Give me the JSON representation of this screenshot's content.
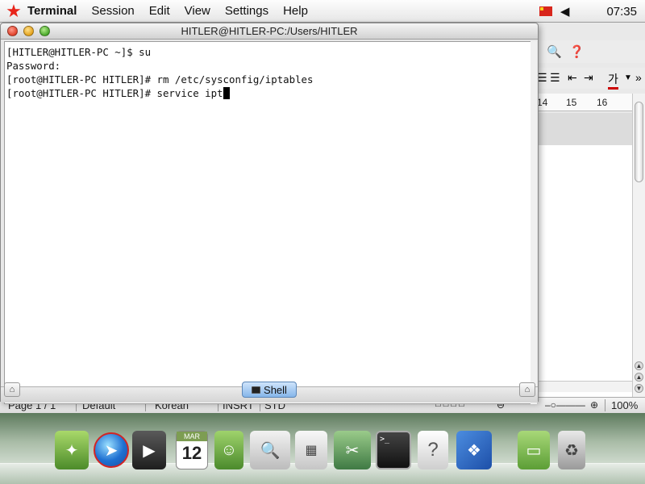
{
  "menubar": {
    "app_name": "Terminal",
    "menus": [
      "Session",
      "Edit",
      "View",
      "Settings",
      "Help"
    ],
    "clock": "07:35",
    "star_color": "#e8241a",
    "icons": [
      "star-icon",
      "flag-icon",
      "volume-icon"
    ]
  },
  "terminal": {
    "window_title": "HITLER@HITLER-PC:/Users/HITLER",
    "lines": [
      "[HITLER@HITLER-PC ~]$ su",
      "Password:",
      "[root@HITLER-PC HITLER]# rm /etc/sysconfig/iptables",
      "[root@HITLER-PC HITLER]# service ipt"
    ],
    "tab_label": "Shell"
  },
  "background_app": {
    "ruler_marks": [
      "14",
      "15",
      "16"
    ],
    "status": {
      "page": "Page 1 / 1",
      "style": "Default",
      "language": "Korean",
      "mode": "INSRT",
      "selection": "STD",
      "zoom": "100%"
    }
  },
  "dock": {
    "calendar_month": "MAR",
    "calendar_day": "12",
    "items": [
      "files",
      "browser",
      "video",
      "calendar",
      "contacts",
      "search",
      "calculator",
      "tools",
      "terminal",
      "help",
      "dictionary",
      "folder",
      "trash"
    ]
  }
}
